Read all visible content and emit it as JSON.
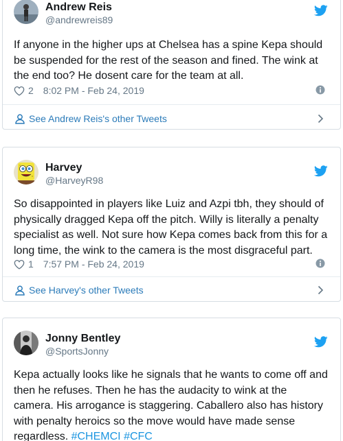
{
  "tweets": [
    {
      "name": "Andrew Reis",
      "handle": "@andrewreis89",
      "text_lines": [
        "If anyone in the higher ups at Chelsea has a spine Kepa should",
        "be suspended for the rest of the season and fined. The wink at",
        "the end too? He dosent care for the team at all."
      ],
      "likes": "2",
      "timestamp": "8:02 PM - Feb 24, 2019",
      "more_link": "See Andrew Reis's other Tweets",
      "avatar_icon": "person-photo-avatar"
    },
    {
      "name": "Harvey",
      "handle": "@HarveyR98",
      "text_lines": [
        "So disappointed in players like Luiz and Azpi tbh, they should of",
        "physically dragged Kepa off the pitch. Willy is literally a penalty",
        "specialist as well. Not sure how Kepa comes back from this for a",
        "long time, the wink to the camera is the most disgraceful part."
      ],
      "likes": "1",
      "timestamp": "7:57 PM - Feb 24, 2019",
      "more_link": "See Harvey's other Tweets",
      "avatar_icon": "spongebob-avatar"
    },
    {
      "name": "Jonny Bentley",
      "handle": "@SportsJonny",
      "text_lines": [
        "Kepa actually looks like he signals that he wants to come off and",
        "then he refuses. Then he has the audacity to wink at the",
        "camera. His arrogance is staggering. Caballero also has history",
        "with penalty heroics so the move would have made sense"
      ],
      "last_line_text": "regardless. ",
      "hashtags": [
        "#CHEMCI",
        "#CFC"
      ],
      "avatar_icon": "bw-photo-avatar"
    }
  ],
  "colors": {
    "twitter_blue": "#1da1f2",
    "link_blue": "#2b7bb9",
    "hashtag_blue": "#1b95e0",
    "muted_gray": "#657786",
    "text": "#14171a",
    "border": "#d6dde3"
  }
}
